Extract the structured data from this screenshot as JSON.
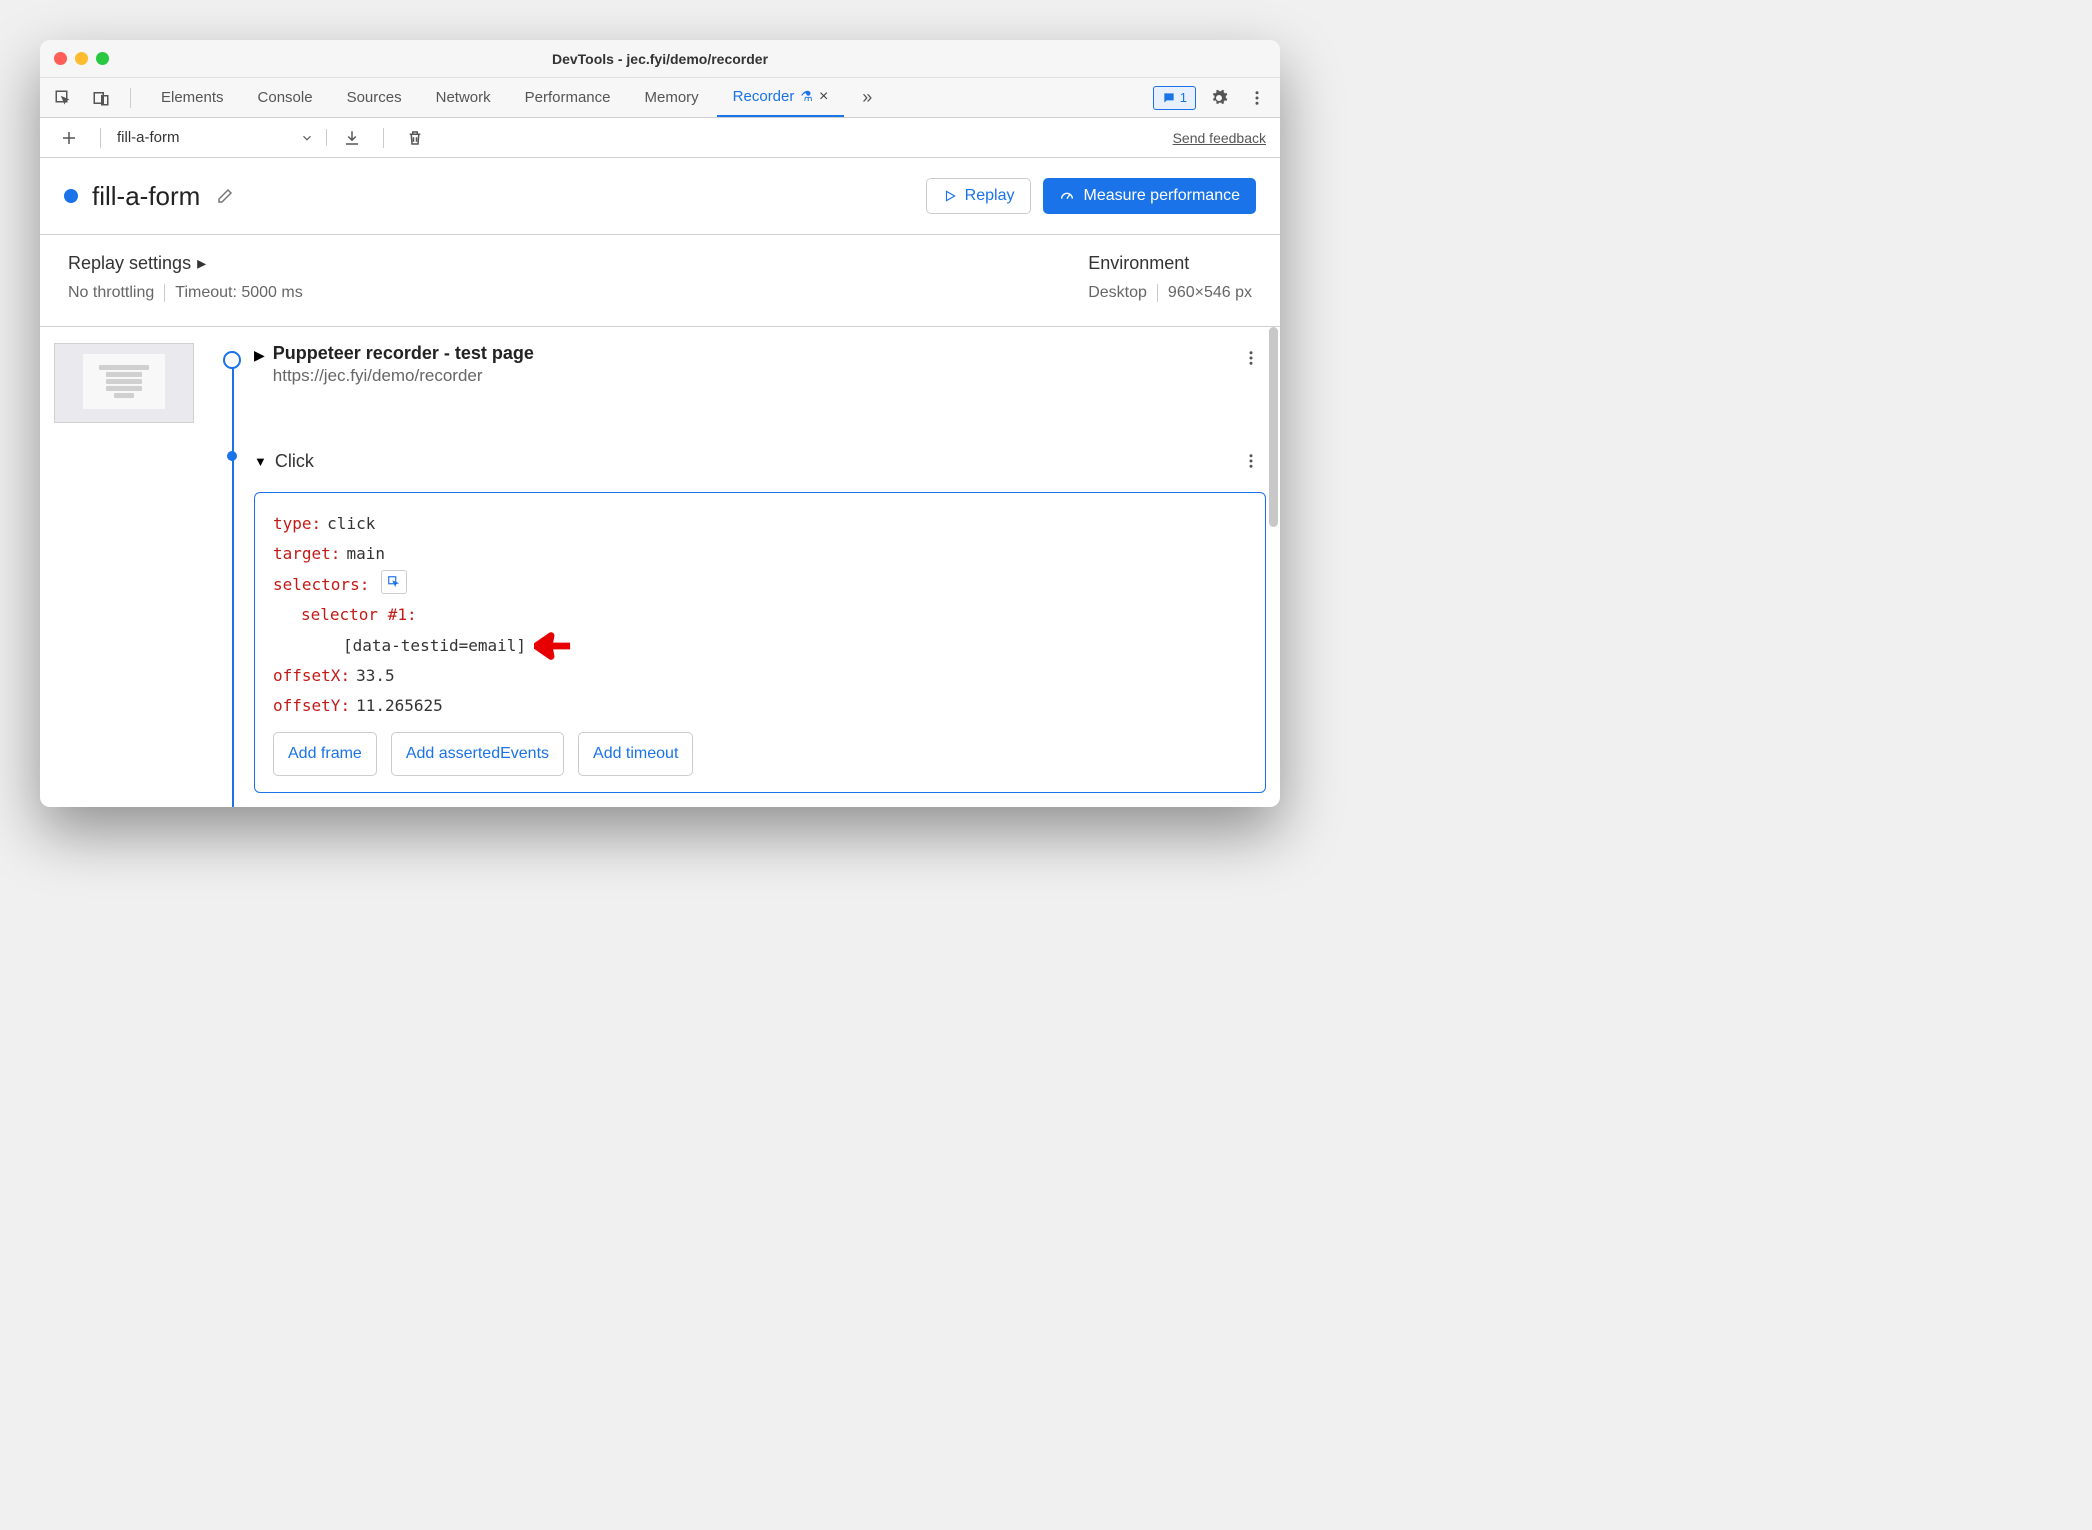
{
  "window": {
    "title": "DevTools - jec.fyi/demo/recorder"
  },
  "tabs": {
    "items": [
      "Elements",
      "Console",
      "Sources",
      "Network",
      "Performance",
      "Memory",
      "Recorder"
    ],
    "active": "Recorder",
    "issues_count": "1"
  },
  "toolbar": {
    "selected_recording": "fill-a-form",
    "feedback": "Send feedback"
  },
  "header": {
    "recording_name": "fill-a-form",
    "replay_label": "Replay",
    "measure_label": "Measure performance"
  },
  "settings": {
    "replay_heading": "Replay settings",
    "throttling": "No throttling",
    "timeout": "Timeout: 5000 ms",
    "env_heading": "Environment",
    "device": "Desktop",
    "dimensions": "960×546 px"
  },
  "steps": {
    "initial": {
      "title": "Puppeteer recorder - test page",
      "url": "https://jec.fyi/demo/recorder"
    },
    "click": {
      "title": "Click",
      "type_key": "type",
      "type_val": "click",
      "target_key": "target",
      "target_val": "main",
      "selectors_key": "selectors",
      "selector_label": "selector #1",
      "selector_value": "[data-testid=email]",
      "offsetx_key": "offsetX",
      "offsetx_val": "33.5",
      "offsety_key": "offsetY",
      "offsety_val": "11.265625",
      "add_frame": "Add frame",
      "add_asserted": "Add assertedEvents",
      "add_timeout": "Add timeout"
    }
  }
}
